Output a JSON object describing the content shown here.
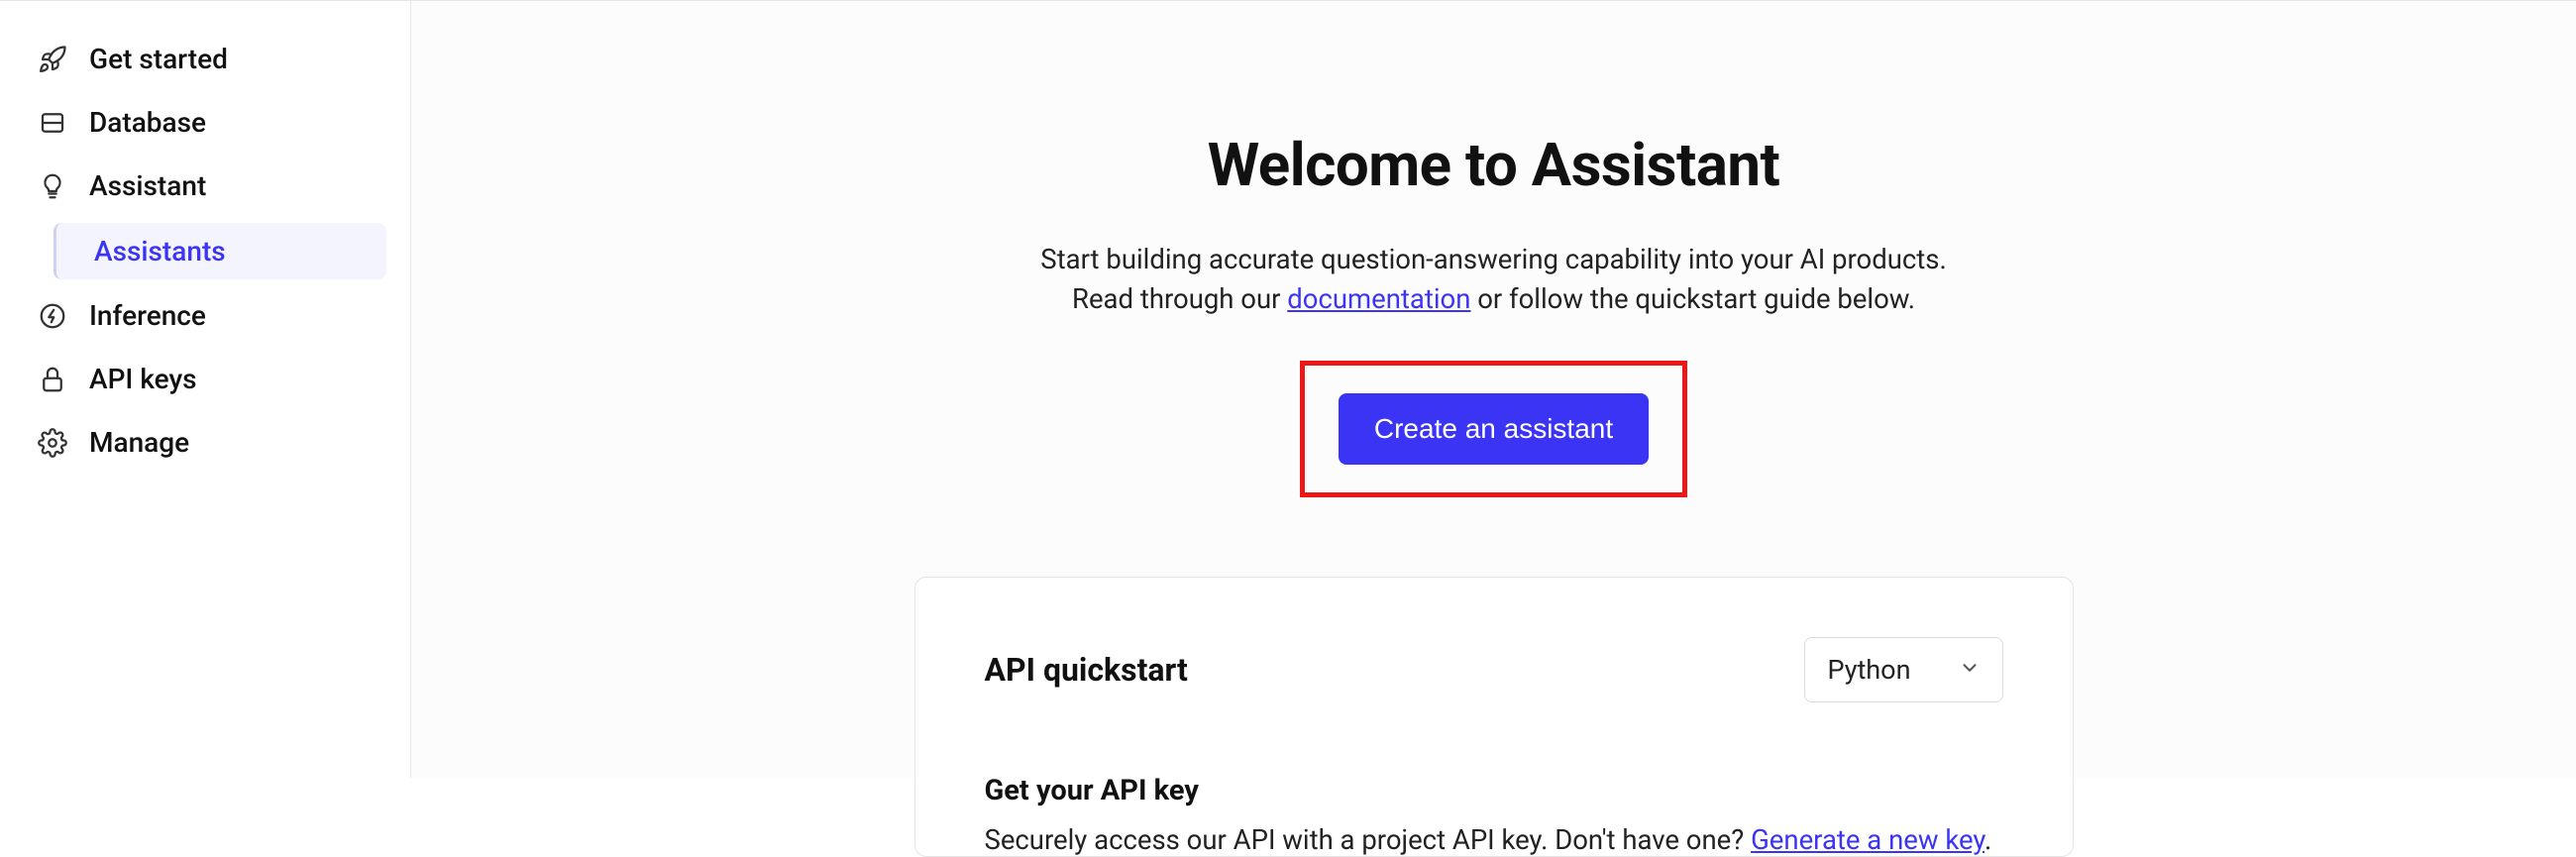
{
  "sidebar": {
    "items": [
      {
        "label": "Get started",
        "icon": "rocket-icon"
      },
      {
        "label": "Database",
        "icon": "database-icon"
      },
      {
        "label": "Assistant",
        "icon": "lightbulb-icon"
      },
      {
        "label": "Inference",
        "icon": "bolt-icon"
      },
      {
        "label": "API keys",
        "icon": "lock-icon"
      },
      {
        "label": "Manage",
        "icon": "gear-icon"
      }
    ],
    "sub": {
      "label": "Assistants"
    }
  },
  "hero": {
    "title": "Welcome to Assistant",
    "line1": "Start building accurate question-answering capability into your AI products.",
    "line2_pre": "Read through our ",
    "line2_link": "documentation",
    "line2_post": " or follow the quickstart guide below.",
    "cta": "Create an assistant"
  },
  "quickstart": {
    "title": "API quickstart",
    "language": "Python",
    "step1": {
      "title": "Get your API key",
      "desc_pre": "Securely access our API with a project API key. Don't have one? ",
      "desc_link": "Generate a new key",
      "desc_post": "."
    }
  },
  "colors": {
    "accent": "#3B34F5",
    "highlight_border": "#ec1818"
  }
}
